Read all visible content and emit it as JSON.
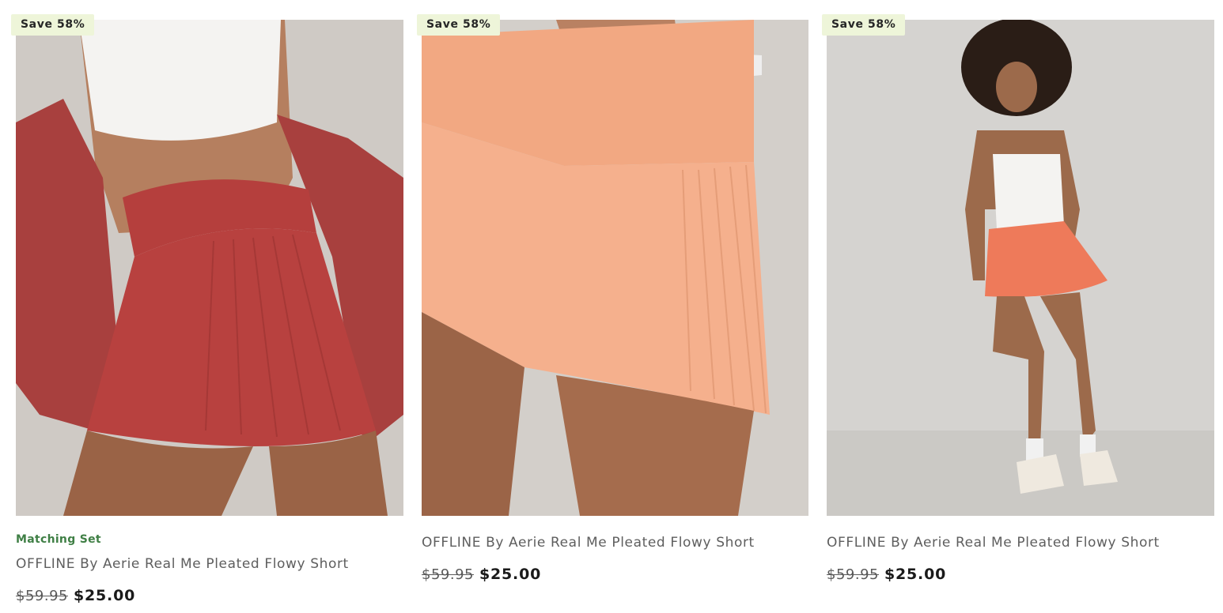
{
  "products": [
    {
      "badge": "Save 58%",
      "tag": "Matching Set",
      "title": "OFFLINE By Aerie Real Me Pleated Flowy Short",
      "price_original": "$59.95",
      "price_sale": "$25.00",
      "color": "#b8413f"
    },
    {
      "badge": "Save 58%",
      "title": "OFFLINE By Aerie Real Me Pleated Flowy Short",
      "price_original": "$59.95",
      "price_sale": "$25.00",
      "color": "#f4ab86"
    },
    {
      "badge": "Save 58%",
      "title": "OFFLINE By Aerie Real Me Pleated Flowy Short",
      "price_original": "$59.95",
      "price_sale": "$25.00",
      "color": "#ee7a5a"
    }
  ],
  "colors": {
    "badge_bg": "#eef5d9",
    "tag_green": "#3f7f45"
  }
}
